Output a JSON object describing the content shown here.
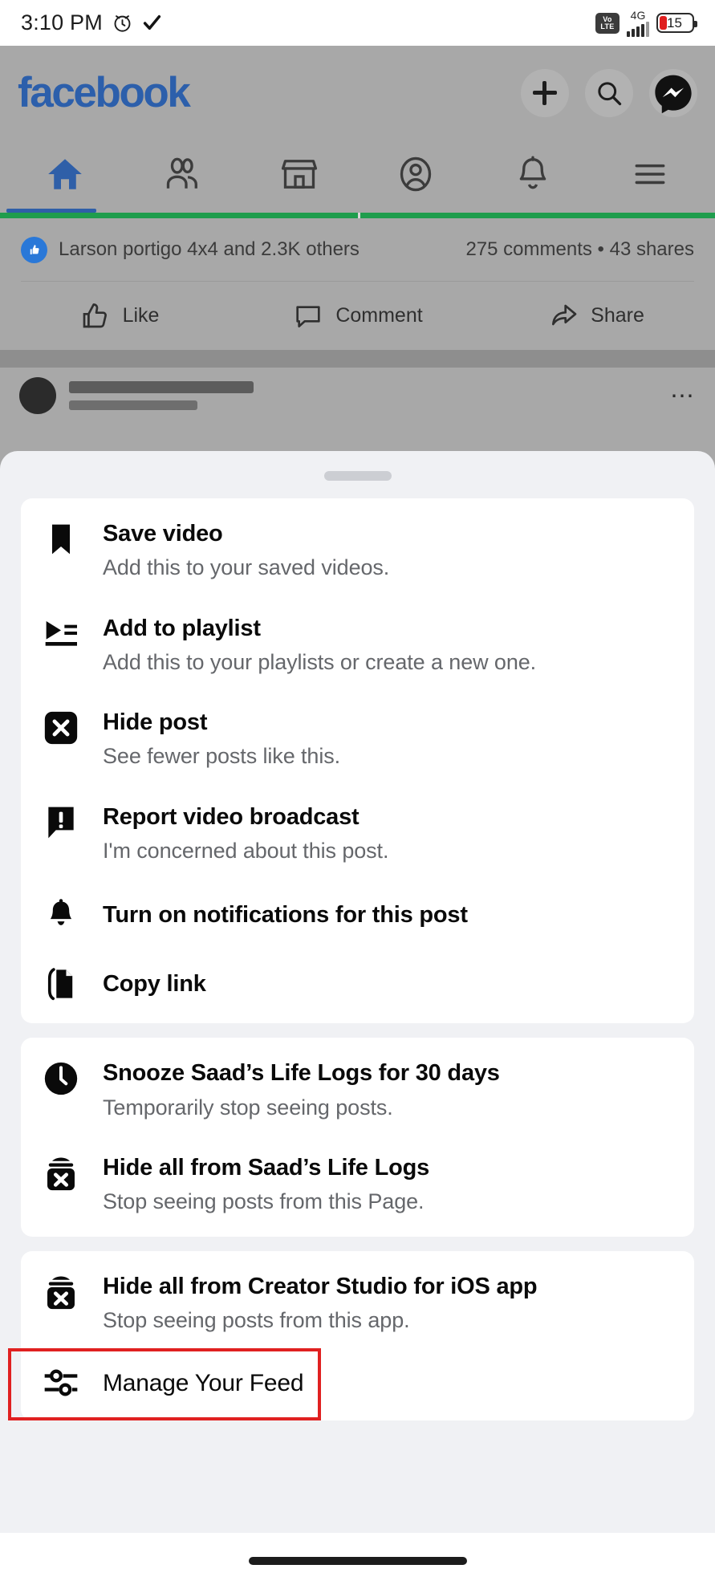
{
  "status_bar": {
    "time": "3:10 PM",
    "alarm_icon": "alarm-clock-icon",
    "check_icon": "checkmark-icon",
    "volte_line1": "Vo",
    "volte_line2": "LTE",
    "network_type": "4G",
    "battery_level": "15"
  },
  "app": {
    "brand": "facebook",
    "header_actions": [
      {
        "name": "create-button",
        "icon": "plus-icon"
      },
      {
        "name": "search-button",
        "icon": "search-icon"
      },
      {
        "name": "messenger-button",
        "icon": "messenger-icon"
      }
    ],
    "tabs": [
      {
        "name": "tab-home",
        "icon": "home-icon",
        "active": true
      },
      {
        "name": "tab-friends",
        "icon": "friends-icon",
        "active": false
      },
      {
        "name": "tab-marketplace",
        "icon": "marketplace-icon",
        "active": false
      },
      {
        "name": "tab-profile",
        "icon": "profile-icon",
        "active": false
      },
      {
        "name": "tab-notifications",
        "icon": "bell-icon",
        "active": false
      },
      {
        "name": "tab-menu",
        "icon": "hamburger-menu-icon",
        "active": false
      }
    ],
    "post": {
      "reactions_text": "Larson portigo 4x4 and 2.3K others",
      "comments_shares": "275 comments  •  43 shares",
      "actions": [
        {
          "name": "like-button",
          "label": "Like",
          "icon": "thumbs-up-icon"
        },
        {
          "name": "comment-button",
          "label": "Comment",
          "icon": "comment-bubble-icon"
        },
        {
          "name": "share-button",
          "label": "Share",
          "icon": "share-arrow-icon"
        }
      ]
    }
  },
  "sheet": {
    "grabber": "drag-handle",
    "sections": [
      {
        "name": "post-actions-card",
        "items": [
          {
            "name": "menu-item-save-video",
            "icon": "bookmark-icon",
            "title": "Save video",
            "subtitle": "Add this to your saved videos."
          },
          {
            "name": "menu-item-add-to-playlist",
            "icon": "playlist-add-icon",
            "title": "Add to playlist",
            "subtitle": "Add this to your playlists or create a new one."
          },
          {
            "name": "menu-item-hide-post",
            "icon": "hide-x-icon",
            "title": "Hide post",
            "subtitle": "See fewer posts like this."
          },
          {
            "name": "menu-item-report-video-broadcast",
            "icon": "report-exclamation-icon",
            "title": "Report video broadcast",
            "subtitle": "I'm concerned about this post."
          },
          {
            "name": "menu-item-turn-on-notifications",
            "icon": "bell-icon",
            "title": "Turn on notifications for this post",
            "subtitle": ""
          },
          {
            "name": "menu-item-copy-link",
            "icon": "copy-link-icon",
            "title": "Copy link",
            "subtitle": ""
          }
        ]
      },
      {
        "name": "page-actions-card",
        "items": [
          {
            "name": "menu-item-snooze-page",
            "icon": "clock-icon",
            "title": "Snooze Saad’s Life Logs for 30 days",
            "subtitle": "Temporarily stop seeing posts."
          },
          {
            "name": "menu-item-hide-all-page",
            "icon": "hide-all-bag-icon",
            "title": "Hide all from Saad’s Life Logs",
            "subtitle": "Stop seeing posts from this Page."
          }
        ]
      },
      {
        "name": "app-actions-card",
        "items": [
          {
            "name": "menu-item-hide-all-app",
            "icon": "hide-all-bag-icon",
            "title": "Hide all from Creator Studio for iOS app",
            "subtitle": "Stop seeing posts from this app."
          },
          {
            "name": "menu-item-manage-your-feed",
            "icon": "sliders-icon",
            "title": "Manage Your Feed",
            "subtitle": "",
            "highlighted": true
          }
        ]
      }
    ]
  },
  "colors": {
    "brand_blue": "#2c5fab",
    "annotation_red": "#e02020",
    "sheet_bg": "#f0f1f4",
    "card_bg": "#ffffff",
    "title_text": "#0a0a0a",
    "subtitle_text": "#65676b",
    "progress_green": "#1f9d4d",
    "battery_red": "#e01f1f"
  },
  "gesture_bar": {
    "name": "home-gesture-pill"
  }
}
